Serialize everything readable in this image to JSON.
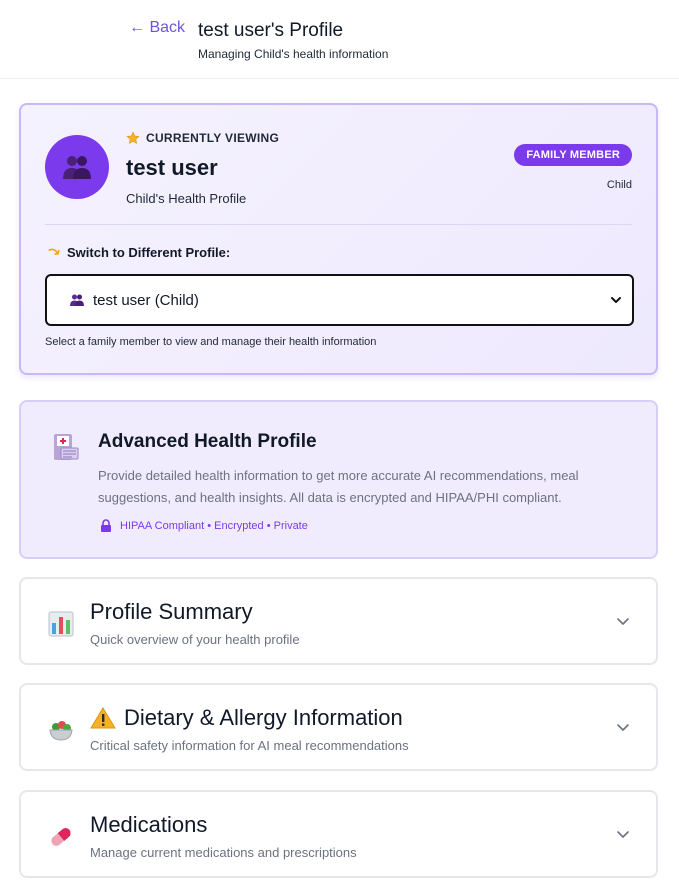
{
  "header": {
    "back_label": "← Back",
    "title": "test user's Profile",
    "subtitle": "Managing Child's health information"
  },
  "viewing": {
    "label": "CURRENTLY VIEWING",
    "name": "test user",
    "profile_type": "Child's Health Profile",
    "badge": "FAMILY MEMBER",
    "relation": "Child",
    "switch_label": "Switch to Different Profile:",
    "selected_option": "test user (Child)",
    "help_text": "Select a family member to view and manage their health information"
  },
  "advanced": {
    "title": "Advanced Health Profile",
    "description": "Provide detailed health information to get more accurate AI recommendations, meal suggestions, and health insights. All data is encrypted and HIPAA/PHI compliant.",
    "badge": "HIPAA Compliant • Encrypted • Private"
  },
  "sections": [
    {
      "title": "Profile Summary",
      "subtitle": "Quick overview of your health profile",
      "icon": "bar-chart-icon"
    },
    {
      "title": "Dietary & Allergy Information",
      "subtitle": "Critical safety information for AI meal recommendations",
      "icon": "salad-bowl-icon"
    },
    {
      "title": "Medications",
      "subtitle": "Manage current medications and prescriptions",
      "icon": "pill-icon"
    }
  ],
  "colors": {
    "accent": "#7c3aed",
    "card_border": "#c8b8f5",
    "back_link": "#6d55d9"
  }
}
